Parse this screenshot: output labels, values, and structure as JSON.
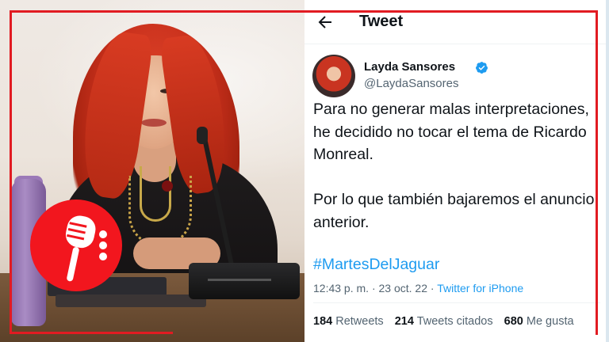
{
  "tweet": {
    "header_title": "Tweet",
    "user_name": "Layda Sansores",
    "user_handle": "@LaydaSansores",
    "text_paragraph_1": "Para no generar malas interpretaciones, he decidido no tocar el tema de Ricardo Monreal.",
    "text_paragraph_2": "Por lo que también bajaremos el anuncio anterior.",
    "hashtag": "#MartesDelJaguar",
    "time": "12:43 p. m.",
    "date": "23 oct. 22",
    "separator": "·",
    "source": "Twitter for iPhone",
    "stats": {
      "retweets_count": "184",
      "retweets_label": "Retweets",
      "quotes_count": "214",
      "quotes_label": "Tweets citados",
      "likes_count": "680",
      "likes_label": "Me gusta"
    }
  },
  "icons": {
    "back": "arrow-left-icon",
    "verified": "verified-badge-icon",
    "podcast": "microphone-icon"
  },
  "colors": {
    "frame_red": "#e11b22",
    "badge_red": "#f2161e",
    "link_blue": "#1d9bf0",
    "text_dark": "#0f1419",
    "text_gray": "#536471"
  }
}
